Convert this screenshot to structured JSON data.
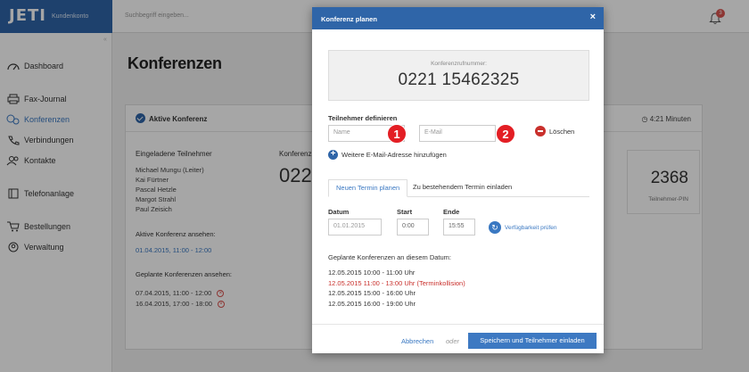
{
  "app": {
    "brand": "JETI",
    "brand_sub": "Kundenkonto",
    "search_placeholder": "Suchbegriff eingeben...",
    "notification_count": "3"
  },
  "sidebar": {
    "collapse": "«",
    "items": [
      {
        "label": "Dashboard",
        "icon": "dashboard-icon"
      },
      {
        "label": "Fax-Journal",
        "icon": "printer-icon"
      },
      {
        "label": "Konferenzen",
        "icon": "conference-icon"
      },
      {
        "label": "Verbindungen",
        "icon": "phone-icon"
      },
      {
        "label": "Kontakte",
        "icon": "contacts-icon"
      },
      {
        "label": "Telefonanlage",
        "icon": "phone-system-icon"
      },
      {
        "label": "Bestellungen",
        "icon": "cart-icon"
      },
      {
        "label": "Verwaltung",
        "icon": "admin-icon"
      }
    ]
  },
  "main": {
    "title": "Konferenzen",
    "active_conference": {
      "title": "Aktive Konferenz",
      "timer": "4:21 Minuten",
      "invited_label": "Eingeladene Teilnehmer",
      "participants": [
        "Michael Mungu (Leiter)",
        "Kai Fürtner",
        "Pascal Hetzle",
        "Margot Strahl",
        "Paul Zeisich"
      ],
      "number_label": "Konferenzrufnummer",
      "number_partial": "022",
      "view_active_label": "Aktive Konferenz ansehen:",
      "view_active_link": "01.04.2015, 11:00 - 12:00",
      "view_planned_label": "Geplante Konferenzen ansehen:",
      "planned": [
        "07.04.2015, 11:00 - 12:00",
        "16.04.2015, 17:00 - 18:00"
      ],
      "pin": "2368",
      "pin_label": "Teilnehmer-PIN"
    }
  },
  "modal": {
    "title": "Konferenz planen",
    "close": "×",
    "conf_number_label": "Konferenzrufnummer:",
    "conf_number": "0221 15462325",
    "participants_label": "Teilnehmer definieren",
    "name_placeholder": "Name",
    "email_placeholder": "E-Mail",
    "badge1": "1",
    "badge2": "2",
    "delete_label": "Löschen",
    "add_email_label": "Weitere E-Mail-Adresse hinzufügen",
    "tabs": [
      "Neuen Termin planen",
      "Zu bestehendem Termin einladen"
    ],
    "date_label": "Datum",
    "start_label": "Start",
    "end_label": "Ende",
    "date_value": "01.01.2015",
    "start_value": "0:00",
    "end_value": "15:55",
    "check_label": "Verfügbarkeit prüfen",
    "planned_label": "Geplante Konferenzen an diesem Datum:",
    "planned_list": [
      "12.05.2015 10:00 - 11:00 Uhr",
      "12.05.2015 11:00 - 13:00 Uhr (Terminkollision)",
      "12.05.2015 15:00 - 16:00 Uhr",
      "12.05.2015 16:00 - 19:00 Uhr"
    ],
    "cancel_label": "Abbrechen",
    "or_label": "oder",
    "save_label": "Speichern und Teilnehmer einladen"
  },
  "colors": {
    "brand_blue": "#2f65a8",
    "link_blue": "#3a78c2",
    "conflict_red": "#c9302c",
    "badge_red": "#e31e24"
  }
}
